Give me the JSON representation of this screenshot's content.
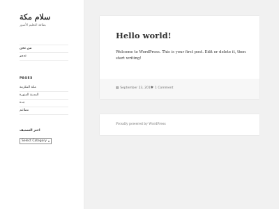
{
  "site": {
    "title": "سلام مكة",
    "description": "بطاقة التعليم الأسور"
  },
  "menu": {
    "items": [
      {
        "label": "من نحن"
      },
      {
        "label": "تدمر"
      }
    ]
  },
  "pages_widget": {
    "title": "PAGES",
    "items": [
      {
        "label": "مكة المكرمة"
      },
      {
        "label": "المدينة المنورة"
      },
      {
        "label": "جدة"
      },
      {
        "label": "مطاعم"
      }
    ]
  },
  "categories_widget": {
    "title": "اختر التصنيف",
    "select_value": "Select Category"
  },
  "post": {
    "title": "Hello world!",
    "body": "Welcome to WordPress. This is your first post. Edit or delete it, then start writing!",
    "date": "September 23, 2019",
    "comments": "1 Comment"
  },
  "footer": {
    "credit": "Proudly powered by WordPress"
  }
}
